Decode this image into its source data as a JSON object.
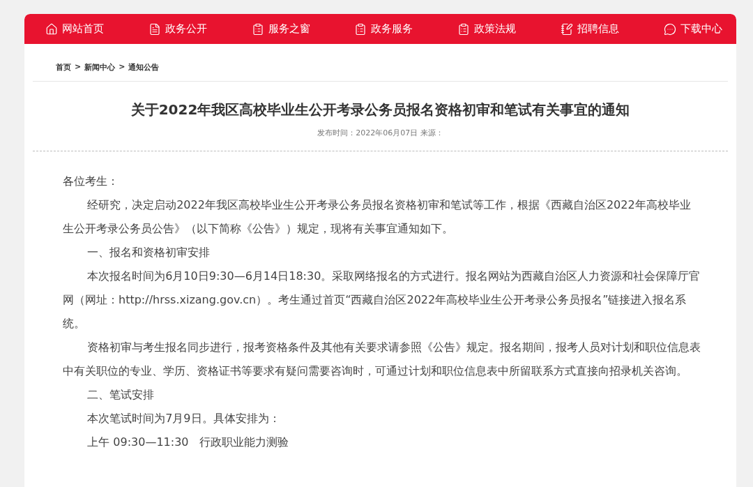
{
  "nav": [
    {
      "label": "网站首页"
    },
    {
      "label": "政务公开"
    },
    {
      "label": "服务之窗"
    },
    {
      "label": "政务服务"
    },
    {
      "label": "政策法规"
    },
    {
      "label": "招聘信息"
    },
    {
      "label": "下载中心"
    }
  ],
  "breadcrumb": {
    "separator": ">",
    "items": [
      "首页",
      "新闻中心",
      "通知公告"
    ]
  },
  "article": {
    "title": "关于2022年我区高校毕业生公开考录公务员报名资格初审和笔试有关事宜的通知",
    "meta": "发布时间：2022年06月07日 来源：",
    "paragraphs": [
      {
        "kind": "salutation",
        "text": "各位考生："
      },
      {
        "kind": "paragraph",
        "text": "经研究，决定启动2022年我区高校毕业生公开考录公务员报名资格初审和笔试等工作，根据《西藏自治区2022年高校毕业生公开考录公务员公告》（以下简称《公告》）规定，现将有关事宜通知如下。"
      },
      {
        "kind": "paragraph",
        "text": "一、报名和资格初审安排"
      },
      {
        "kind": "paragraph",
        "text": "本次报名时间为6月10日9:30—6月14日18:30。采取网络报名的方式进行。报名网站为西藏自治区人力资源和社会保障厅官网（网址：http://hrss.xizang.gov.cn）。考生通过首页“西藏自治区2022年高校毕业生公开考录公务员报名”链接进入报名系统。"
      },
      {
        "kind": "paragraph",
        "text": "资格初审与考生报名同步进行，报考资格条件及其他有关要求请参照《公告》规定。报名期间，报考人员对计划和职位信息表中有关职位的专业、学历、资格证书等要求有疑问需要咨询时，可通过计划和职位信息表中所留联系方式直接向招录机关咨询。"
      },
      {
        "kind": "paragraph",
        "text": "二、笔试安排"
      },
      {
        "kind": "paragraph",
        "text": "本次笔试时间为7月9日。具体安排为："
      },
      {
        "kind": "paragraph",
        "text": "上午 09:30—11:30   行政职业能力测验"
      }
    ]
  }
}
